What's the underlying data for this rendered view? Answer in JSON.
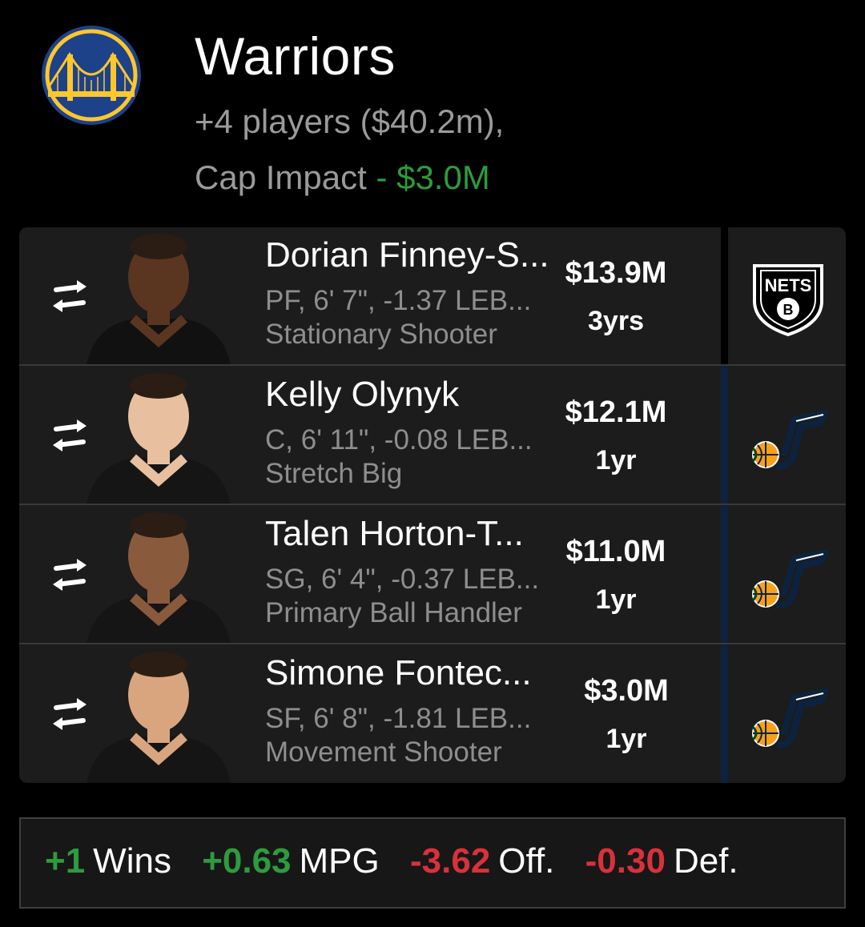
{
  "team": {
    "name": "Warriors",
    "players_line": "+4 players ($40.2m),",
    "cap_label": "Cap Impact",
    "cap_value": "- $3.0M",
    "logo_icon": "warriors-bridge-logo",
    "colors": {
      "primary": "#1d428a",
      "secondary": "#ffc72c"
    }
  },
  "players": [
    {
      "name": "Dorian Finney-S...",
      "meta": "PF, 6' 7\", -1.37 LEB...",
      "archetype": "Stationary Shooter",
      "salary": "$13.9M",
      "years": "3yrs",
      "from_team": "nets-logo",
      "team_label": "NETS",
      "team_color": "#000000"
    },
    {
      "name": "Kelly Olynyk",
      "meta": "C, 6' 11\", -0.08 LEB...",
      "archetype": "Stretch Big",
      "salary": "$12.1M",
      "years": "1yr",
      "from_team": "jazz-logo",
      "team_color": "#0c2340"
    },
    {
      "name": "Talen Horton-T...",
      "meta": "SG, 6' 4\", -0.37 LEB...",
      "archetype": "Primary Ball Handler",
      "salary": "$11.0M",
      "years": "1yr",
      "from_team": "jazz-logo",
      "team_color": "#0c2340"
    },
    {
      "name": "Simone Fontec...",
      "meta": "SF, 6' 8\", -1.81 LEB...",
      "archetype": "Movement Shooter",
      "salary": "$3.0M",
      "years": "1yr",
      "from_team": "jazz-logo",
      "team_color": "#0c2340"
    }
  ],
  "summary": {
    "wins_value": "+1",
    "wins_label": "Wins",
    "mpg_value": "+0.63",
    "mpg_label": "MPG",
    "off_value": "-3.62",
    "off_label": "Off.",
    "def_value": "-0.30",
    "def_label": "Def."
  }
}
